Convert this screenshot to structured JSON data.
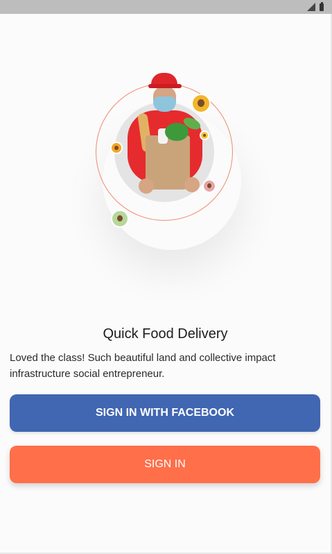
{
  "status_bar": {
    "icons": [
      "signal-icon",
      "battery-icon"
    ],
    "background": "#bdbdbd"
  },
  "hero": {
    "image": "delivery-courier-with-grocery-bag",
    "ring_color": "#f08a6e",
    "avatars": [
      "courier-avatar",
      "courier-avatar",
      "courier-avatar",
      "courier-avatar",
      "courier-avatar"
    ]
  },
  "content": {
    "title": "Quick Food Delivery",
    "subtitle": "Loved the class! Such beautiful land and collective impact infrastructure social entrepreneur."
  },
  "buttons": {
    "facebook_label": "SIGN IN WITH FACEBOOK",
    "facebook_color": "#4166b2",
    "signin_label": "SIGN IN",
    "signin_color": "#ff6f4a"
  }
}
